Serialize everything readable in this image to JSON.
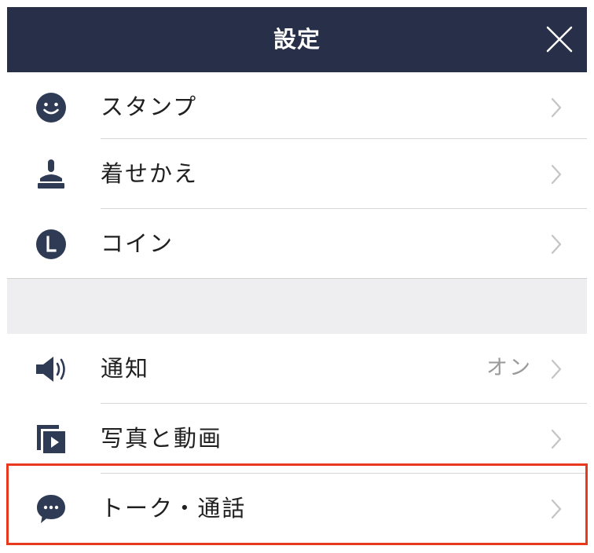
{
  "header": {
    "title": "設定"
  },
  "section1": [
    {
      "label": "スタンプ",
      "icon": "smiley-icon"
    },
    {
      "label": "着せかえ",
      "icon": "brush-icon"
    },
    {
      "label": "コイン",
      "icon": "coin-l-icon"
    }
  ],
  "section2": [
    {
      "label": "通知",
      "value": "オン",
      "icon": "speaker-icon"
    },
    {
      "label": "写真と動画",
      "icon": "photo-video-icon"
    },
    {
      "label": "トーク・通話",
      "icon": "chat-bubble-icon"
    }
  ],
  "colors": {
    "header_bg": "#283049",
    "icon": "#2f3a55",
    "highlight": "#e8391e"
  }
}
